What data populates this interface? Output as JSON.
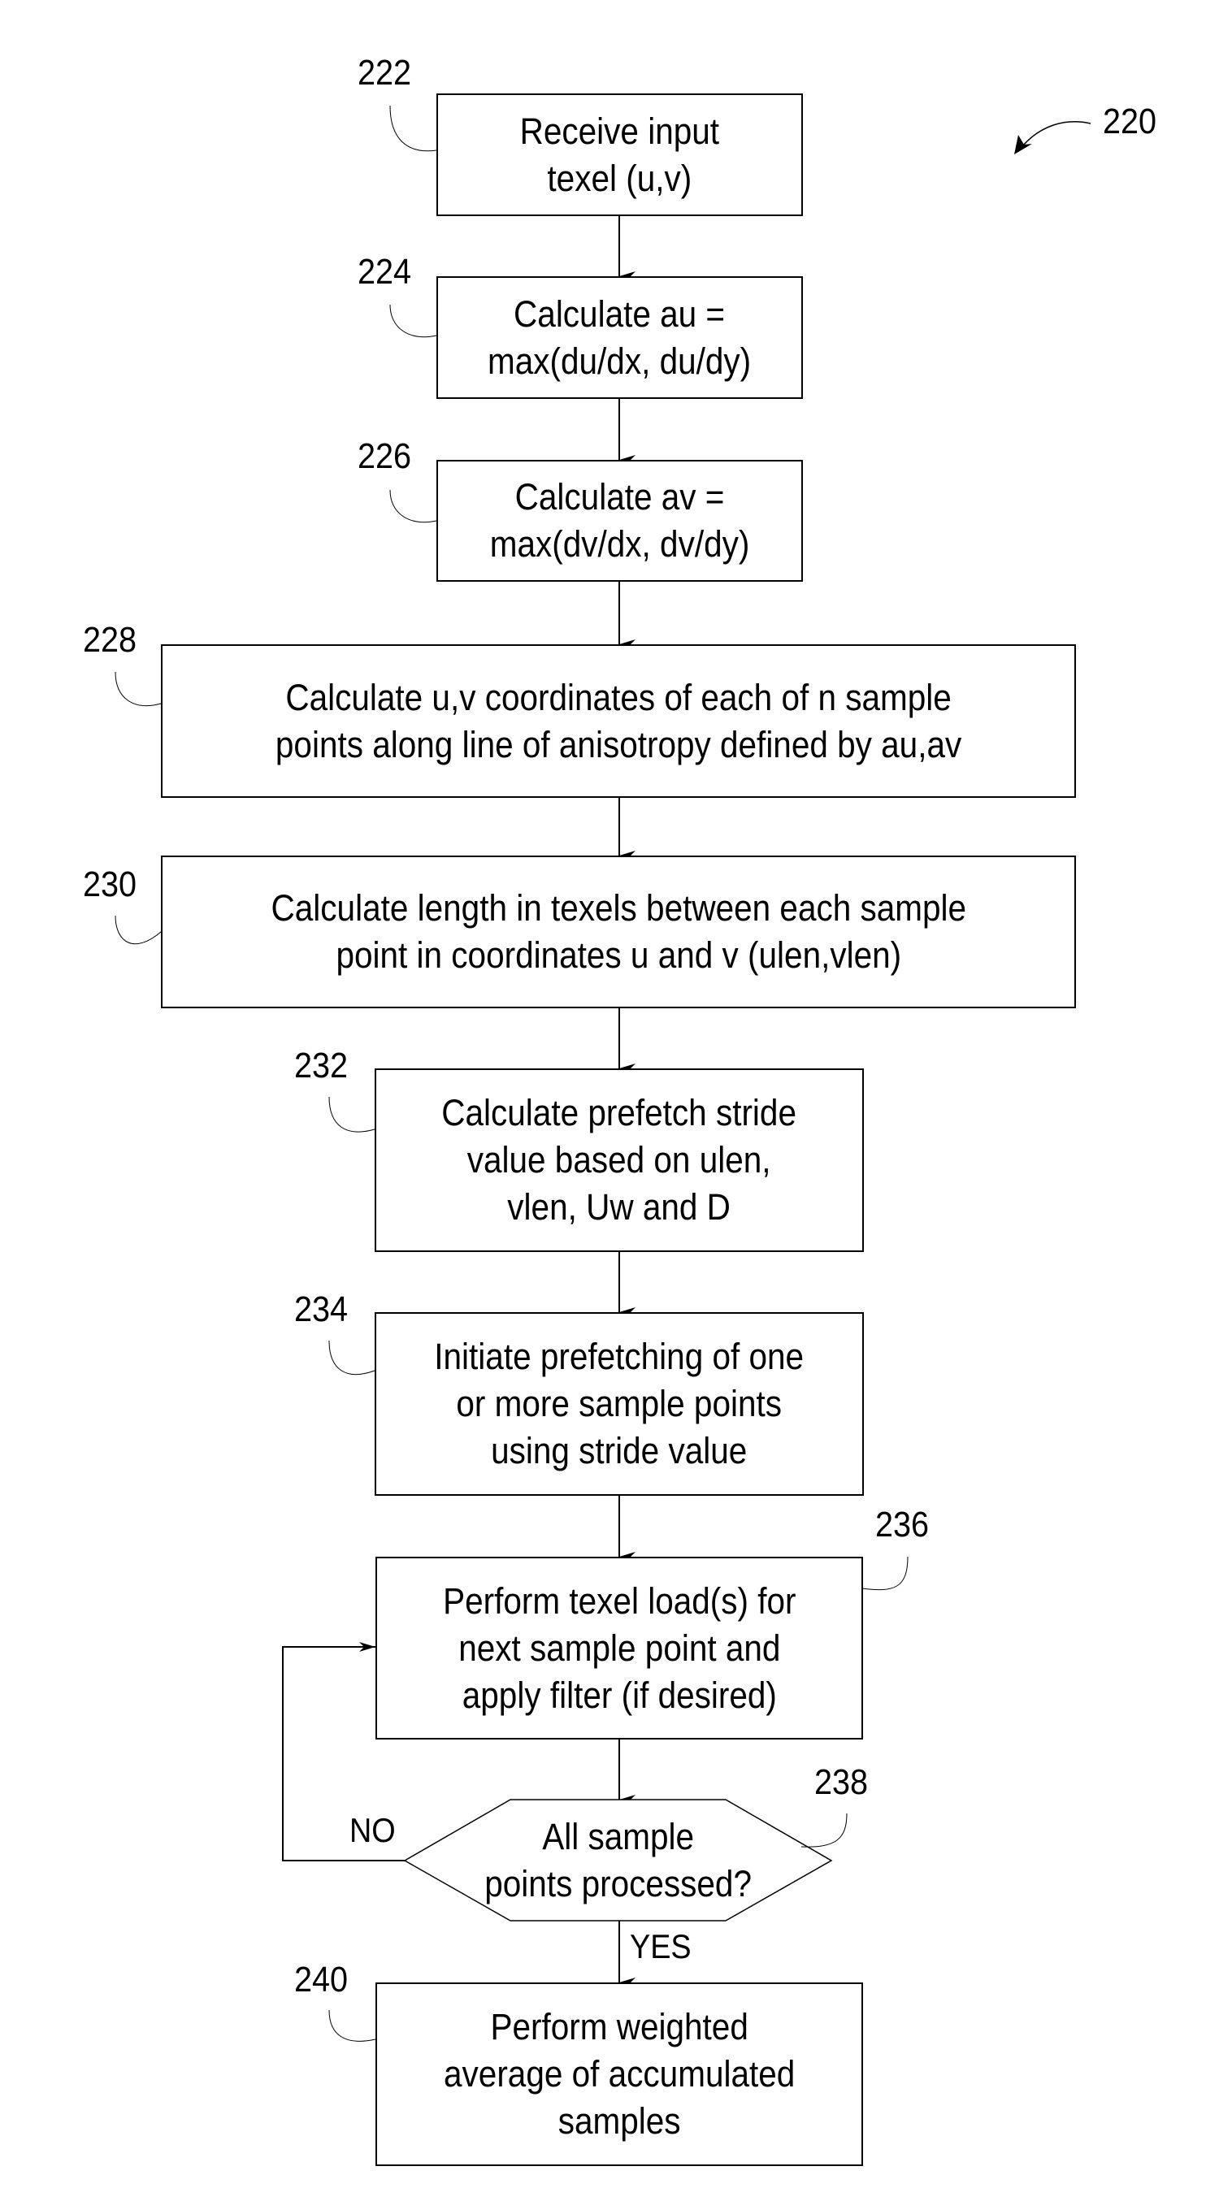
{
  "figure": {
    "reference": "220",
    "steps": [
      {
        "ref": "222",
        "text": "Receive input\ntexel (u,v)"
      },
      {
        "ref": "224",
        "text": "Calculate au =\nmax(du/dx, du/dy)"
      },
      {
        "ref": "226",
        "text": "Calculate av =\nmax(dv/dx, dv/dy)"
      },
      {
        "ref": "228",
        "text": "Calculate u,v coordinates of each of n sample\npoints along line of anisotropy defined by au,av"
      },
      {
        "ref": "230",
        "text": "Calculate length in texels between each sample\npoint in coordinates u and v (ulen,vlen)"
      },
      {
        "ref": "232",
        "text": "Calculate prefetch stride\nvalue based on ulen,\nvlen, Uw and D"
      },
      {
        "ref": "234",
        "text": "Initiate prefetching of one\nor more sample points\nusing stride value"
      },
      {
        "ref": "236",
        "text": "Perform texel load(s) for\nnext sample point and\napply filter (if desired)"
      },
      {
        "ref": "240",
        "text": "Perform weighted\naverage of accumulated\nsamples"
      }
    ],
    "decision": {
      "ref": "238",
      "text": "All sample\npoints processed?",
      "no_label": "NO",
      "yes_label": "YES"
    }
  }
}
